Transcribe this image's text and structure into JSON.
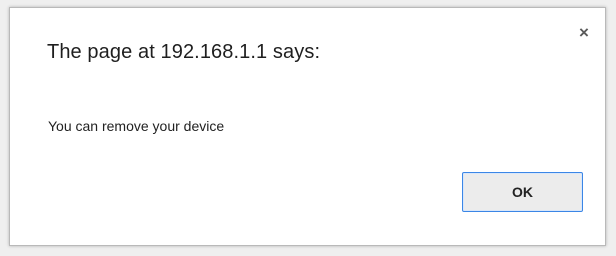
{
  "dialog": {
    "title": "The page at 192.168.1.1 says:",
    "close_glyph": "×",
    "message": "You can remove your device",
    "ok_label": "OK"
  },
  "icons": {
    "close": "close-icon"
  },
  "colors": {
    "dialog_background": "#ffffff",
    "page_background": "#efefef",
    "button_focus_border": "#3b86e6",
    "button_background": "#ececec"
  }
}
